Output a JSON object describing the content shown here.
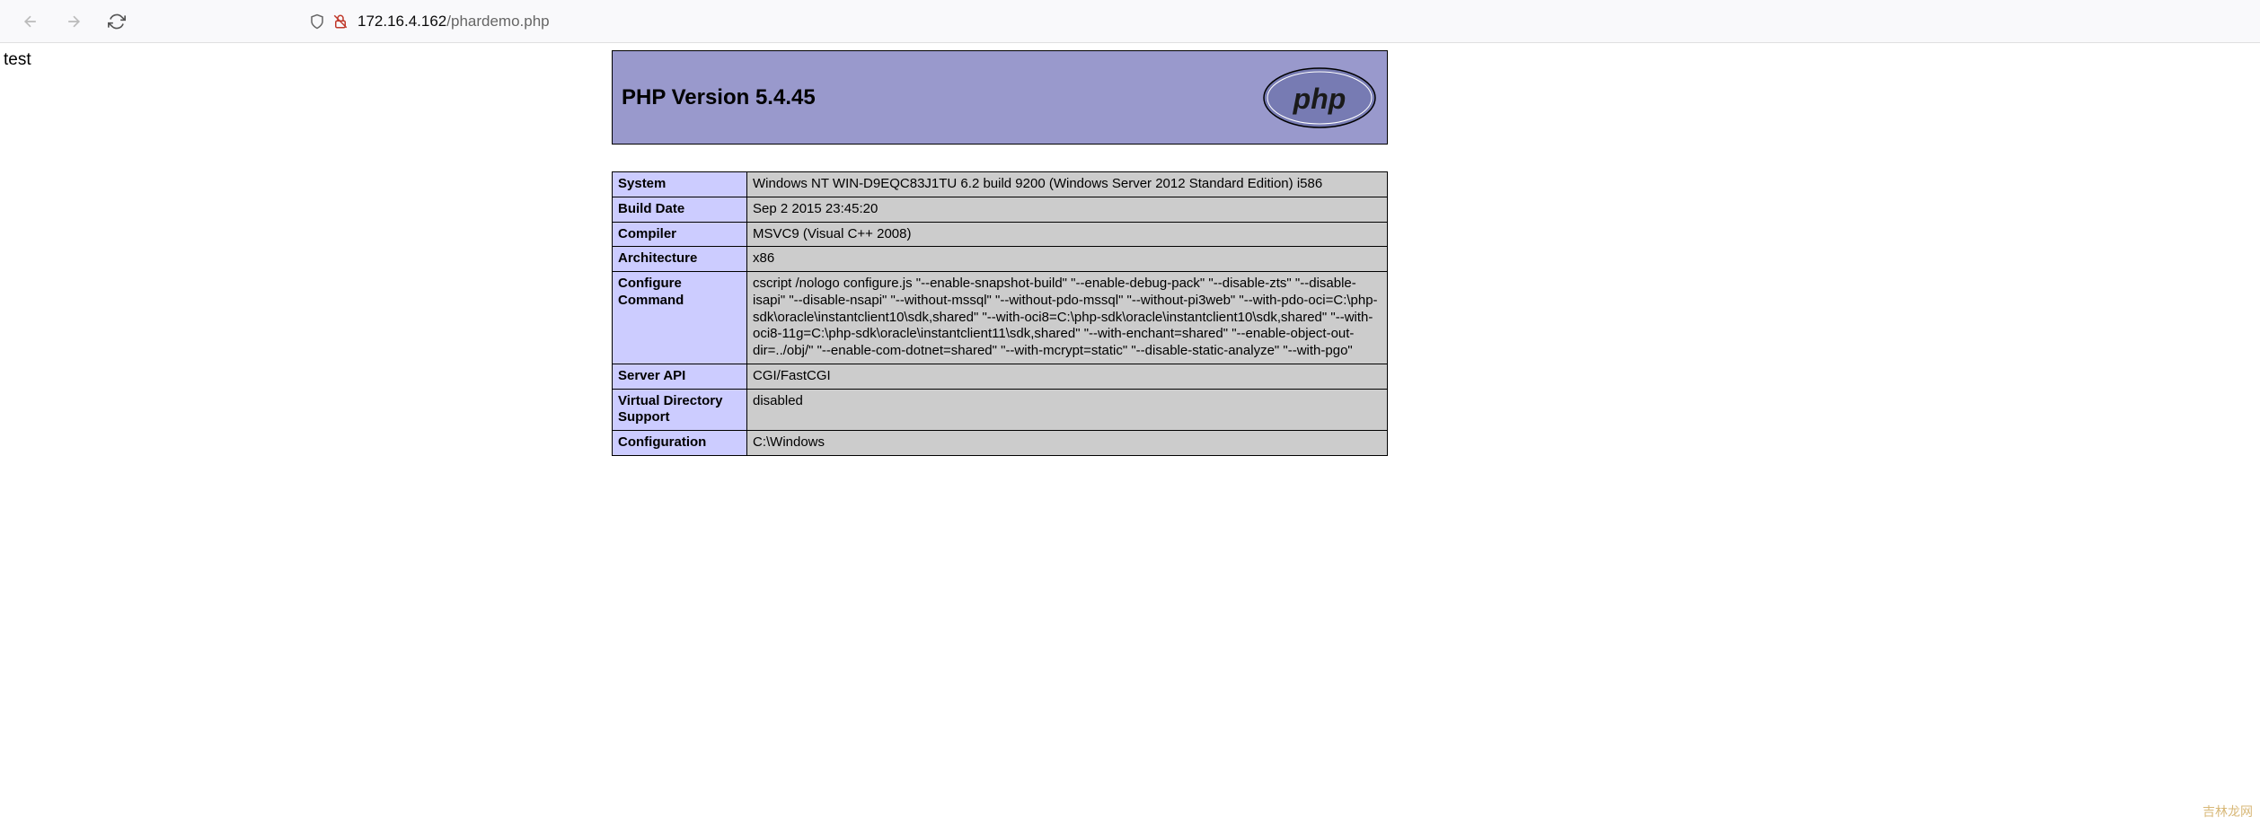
{
  "browser": {
    "url_host": "172.16.4.162",
    "url_path": "/phardemo.php"
  },
  "page": {
    "test_text": "test"
  },
  "phpinfo": {
    "title": "PHP Version 5.4.45",
    "rows": [
      {
        "label": "System",
        "value": "Windows NT WIN-D9EQC83J1TU 6.2 build 9200 (Windows Server 2012 Standard Edition) i586"
      },
      {
        "label": "Build Date",
        "value": "Sep 2 2015 23:45:20"
      },
      {
        "label": "Compiler",
        "value": "MSVC9 (Visual C++ 2008)"
      },
      {
        "label": "Architecture",
        "value": "x86"
      },
      {
        "label": "Configure Command",
        "value": "cscript /nologo configure.js \"--enable-snapshot-build\" \"--enable-debug-pack\" \"--disable-zts\" \"--disable-isapi\" \"--disable-nsapi\" \"--without-mssql\" \"--without-pdo-mssql\" \"--without-pi3web\" \"--with-pdo-oci=C:\\php-sdk\\oracle\\instantclient10\\sdk,shared\" \"--with-oci8=C:\\php-sdk\\oracle\\instantclient10\\sdk,shared\" \"--with-oci8-11g=C:\\php-sdk\\oracle\\instantclient11\\sdk,shared\" \"--with-enchant=shared\" \"--enable-object-out-dir=../obj/\" \"--enable-com-dotnet=shared\" \"--with-mcrypt=static\" \"--disable-static-analyze\" \"--with-pgo\""
      },
      {
        "label": "Server API",
        "value": "CGI/FastCGI"
      },
      {
        "label": "Virtual Directory Support",
        "value": "disabled"
      },
      {
        "label": "Configuration",
        "value": "C:\\Windows"
      }
    ]
  },
  "watermark": "吉林龙网"
}
